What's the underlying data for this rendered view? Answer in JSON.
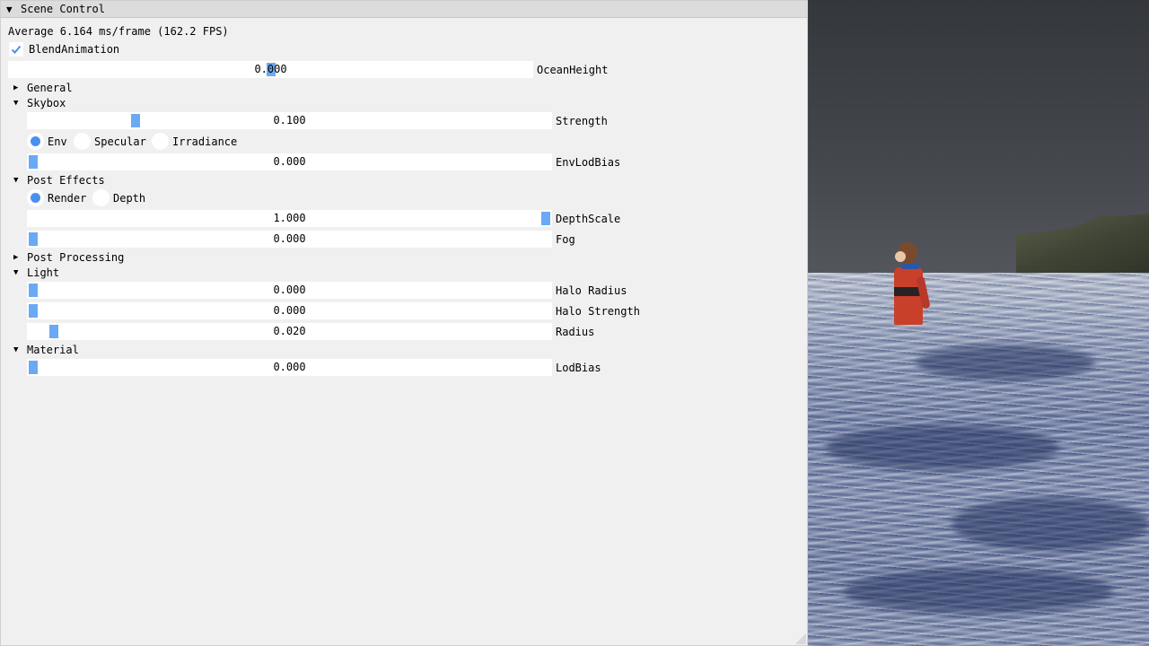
{
  "window": {
    "title": "Scene Control",
    "title_arrow": "▼"
  },
  "stats": {
    "text": "Average 6.164 ms/frame (162.2 FPS)"
  },
  "blend_animation": {
    "label": "BlendAnimation",
    "checked": true
  },
  "ocean_height": {
    "label": "OceanHeight",
    "value": "0.000",
    "fraction": 0.5
  },
  "sections": {
    "general": {
      "label": "General",
      "arrow": "▶",
      "open": false
    },
    "skybox": {
      "label": "Skybox",
      "arrow": "▼",
      "open": true
    },
    "post_effects": {
      "label": "Post Effects",
      "arrow": "▼",
      "open": true
    },
    "post_processing": {
      "label": "Post Processing",
      "arrow": "▶",
      "open": false
    },
    "light": {
      "label": "Light",
      "arrow": "▼",
      "open": true
    },
    "material": {
      "label": "Material",
      "arrow": "▼",
      "open": true
    }
  },
  "skybox": {
    "strength": {
      "label": "Strength",
      "value": "0.100",
      "fraction": 0.2
    },
    "mode_options": [
      "Env",
      "Specular",
      "Irradiance"
    ],
    "mode_selected": "Env",
    "env_lod_bias": {
      "label": "EnvLodBias",
      "value": "0.000",
      "fraction": 0.0
    }
  },
  "post_effects": {
    "view_options": [
      "Render",
      "Depth"
    ],
    "view_selected": "Render",
    "depth_scale": {
      "label": "DepthScale",
      "value": "1.000",
      "fraction": 1.0
    },
    "fog": {
      "label": "Fog",
      "value": "0.000",
      "fraction": 0.0
    }
  },
  "light": {
    "halo_radius": {
      "label": "Halo Radius",
      "value": "0.000",
      "fraction": 0.0
    },
    "halo_strength": {
      "label": "Halo Strength",
      "value": "0.000",
      "fraction": 0.0
    },
    "radius": {
      "label": "Radius",
      "value": "0.020",
      "fraction": 0.04
    }
  },
  "material": {
    "lod_bias": {
      "label": "LodBias",
      "value": "0.000",
      "fraction": 0.0
    }
  },
  "colors": {
    "panel_bg": "#f0f0f0",
    "title_bg": "#dcdcdc",
    "accent": "#6aa9f5",
    "radio_selected": "#4a90ee"
  },
  "icons": {
    "check": "check-icon",
    "expanded": "triangle-down-icon",
    "collapsed": "triangle-right-icon"
  }
}
